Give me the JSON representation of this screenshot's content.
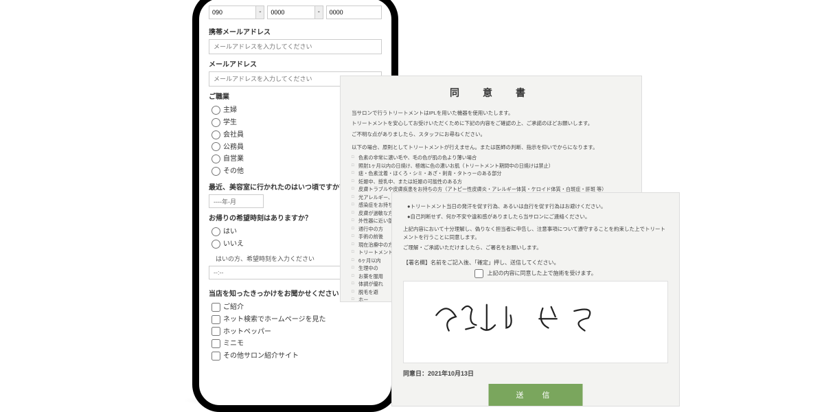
{
  "phone": {
    "tel_parts": [
      "090",
      "0000",
      "0000"
    ],
    "mobile_email_label": "携帯メールアドレス",
    "mobile_email_ph": "メールアドレスを入力してください",
    "email_label": "メールアドレス",
    "email_ph": "メールアドレスを入力してください",
    "occupation_label": "ご職業",
    "occupations": [
      "主婦",
      "学生",
      "会社員",
      "公務員",
      "自営業",
      "その他"
    ],
    "last_visit_label": "最近、美容室に行かれたのはいつ頃ですか？",
    "last_visit_ph": "----年-月",
    "return_time_label": "お帰りの希望時刻はありますか？",
    "yes": "はい",
    "no": "いいえ",
    "time_hint": "はいの方、希望時刻を入力ください",
    "time_ph": "--:--",
    "source_label": "当店を知ったきっかけをお聞かせください",
    "sources": [
      "ご紹介",
      "ネット検索でホームページを見た",
      "ホットペッパー",
      "ミニモ",
      "その他サロン紹介サイト"
    ]
  },
  "consent1": {
    "title": "同　意　書",
    "p1": "当サロンで行うトリートメントはIPLを用いた機器を使用いたします。",
    "p2": "トリートメントを安心してお受けいただくために下記の内容をご確認の上、ご承諾のほどお願いします。",
    "p3": "ご不明な点がありましたら、スタッフにお尋ねください。",
    "p4": "以下の場合、原則としてトリートメントが行えません。または医師の判断、指示を仰いでからになります。",
    "items": [
      "色素の非常に濃い毛や、毛の色が肌の色より薄い場合",
      "照射1ヶ月以内の日焼け、極端に色の濃いお肌（トリートメント期間中の日焼けは禁止）",
      "痣・色素沈着・ほくろ・シミ・あざ・刺青・タトゥーのある部分",
      "妊娠中、授乳中、または妊娠の可能性のある方",
      "皮膚トラブルや皮膚疾患をお持ちの方（アトピー性皮膚炎・アレルギー体質・ケロイド体質・白斑症・肝斑 等）",
      "光アレルギー、予防接種予約皆当反応",
      "感染症をお持ちの方",
      "皮膚が過敏な方",
      "外性器に近い部分",
      "通行中の方",
      "手術の前後",
      "現在治療中の方",
      "トリートメント",
      "6ヶ月以内",
      "生理中の",
      "お薬を服用",
      "体調が優れ",
      "脱毛を避",
      "ホー"
    ]
  },
  "consent2": {
    "b1": "●トリートメント当日の発汗を促す行為、あるいは血行を促す行為はお避けください。",
    "b2": "●自己判断せず、何か不安や違和感がありましたら当サロンにご連絡ください。",
    "p1": "上記内容において十分理解し、偽りなく担当者に申告し、注意事項について遵守することを約束した上でトリートメントを行うことに同意します。",
    "p2": "ご理解・ご承諾いただけましたら、ご署名をお願いします。",
    "sig_label": "【署名欄】名前をご記入後、「確定」押し、送信してください。",
    "sig_check": "上記の内容に同意した上で施術を受けます。",
    "date_label": "同意日：2021年10月13日",
    "send": "送　信"
  }
}
